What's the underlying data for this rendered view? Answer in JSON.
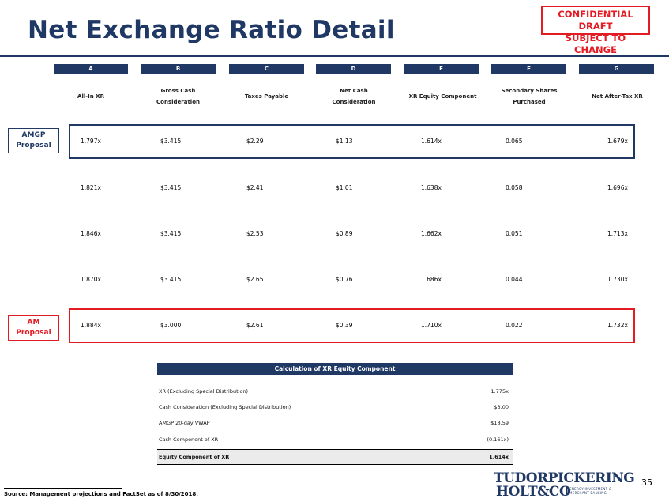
{
  "header": {
    "title": "Net Exchange Ratio Detail",
    "confidential_line1": "CONFIDENTIAL DRAFT",
    "confidential_line2": "SUBJECT TO CHANGE"
  },
  "columns": [
    {
      "letter": "A",
      "name": "All-In XR"
    },
    {
      "letter": "B",
      "name": "Gross Cash Consideration"
    },
    {
      "letter": "C",
      "name": "Taxes Payable"
    },
    {
      "letter": "D",
      "name": "Net Cash Consideration"
    },
    {
      "letter": "E",
      "name": "XR Equity Component"
    },
    {
      "letter": "F",
      "name": "Secondary Shares Purchased"
    },
    {
      "letter": "G",
      "name": "Net After-Tax XR"
    }
  ],
  "rows": [
    {
      "label": "AMGP Proposal",
      "values": [
        "1.797x",
        "$3.415",
        "$2.29",
        "$1.13",
        "1.614x",
        "0.065",
        "1.679x"
      ]
    },
    {
      "label": "",
      "values": [
        "1.821x",
        "$3.415",
        "$2.41",
        "$1.01",
        "1.638x",
        "0.058",
        "1.696x"
      ]
    },
    {
      "label": "",
      "values": [
        "1.846x",
        "$3.415",
        "$2.53",
        "$0.89",
        "1.662x",
        "0.051",
        "1.713x"
      ]
    },
    {
      "label": "",
      "values": [
        "1.870x",
        "$3.415",
        "$2.65",
        "$0.76",
        "1.686x",
        "0.044",
        "1.730x"
      ]
    },
    {
      "label": "AM Proposal",
      "values": [
        "1.884x",
        "$3.000",
        "$2.61",
        "$0.39",
        "1.710x",
        "0.022",
        "1.732x"
      ]
    }
  ],
  "calc": {
    "title": "Calculation of XR Equity Component",
    "rows": [
      {
        "label": "XR (Excluding Special Distribution)",
        "value": "1.775x"
      },
      {
        "label": "Cash Consideration (Excluding Special Distribution)",
        "value": "$3.00"
      },
      {
        "label": "AMGP 20-day VWAP",
        "value": "$18.59"
      },
      {
        "label": "Cash Component of XR",
        "value": "(0.161x)"
      },
      {
        "label": "Equity Component of XR",
        "value": "1.614x"
      }
    ]
  },
  "footer": {
    "source": "Source: Management projections and FactSet as of 8/30/2018.",
    "page_number": "35",
    "logo_line1": "TUDORPICKERING",
    "logo_line2": "HOLT&CO",
    "logo_tagline1": "ENERGY INVESTMENT &",
    "logo_tagline2": "MERCHANT BANKING"
  },
  "colors": {
    "navy": "#1f3864",
    "red": "#e31b23"
  }
}
